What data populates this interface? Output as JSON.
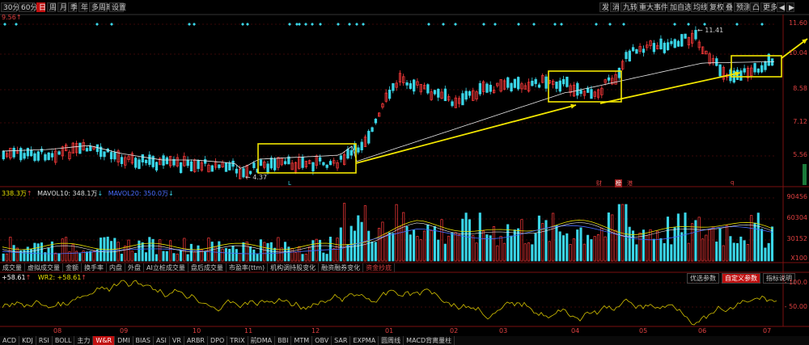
{
  "toolbar": {
    "left_buttons": [
      "30分",
      "60分",
      "日",
      "周",
      "月",
      "季",
      "年",
      "多周期",
      "设置"
    ],
    "active_index": 2,
    "right_buttons": [
      "发",
      "消",
      "九转",
      "重大事件",
      "加自选",
      "均线",
      "复权",
      "叠",
      "预测",
      "凸",
      "更多"
    ]
  },
  "price_panel": {
    "top_value": "9.56",
    "axis": [
      "11.60",
      "10.04",
      "8.58",
      "7.12",
      "5.56"
    ],
    "annotations": {
      "high": "11.41",
      "low": "4.37"
    },
    "event_marks": [
      "L",
      "财",
      "榜",
      "港",
      "q"
    ]
  },
  "volume_legend": {
    "vol": "338.3万",
    "ma10_label": "MAVOL10:",
    "ma10": "348.1万",
    "ma20_label": "MAVOL20:",
    "ma20": "350.0万"
  },
  "volume_axis": [
    "90456",
    "60304",
    "30152",
    "X100"
  ],
  "indicator_tabs": [
    "成交量",
    "虚拟成交量",
    "金额",
    "换手率",
    "内盘",
    "外盘",
    "AI立桩成交量",
    "盘后成交量",
    "市盈率(ttm)",
    "机构调持股变化",
    "融资融券变化",
    "资金抄底"
  ],
  "wr_legend": {
    "wr1": "+58.61",
    "wr2_label": "WR2:",
    "wr2": "+58.61"
  },
  "wr_buttons": [
    "优选参数",
    "自定义参数",
    "指标说明"
  ],
  "wr_axis": [
    "100.0",
    "50.00"
  ],
  "dates": [
    "08",
    "09",
    "10",
    "11",
    "12",
    "01",
    "02",
    "03",
    "04",
    "05",
    "06",
    "07"
  ],
  "bottom_tabs": [
    "ACD",
    "KDJ",
    "RSI",
    "BOLL",
    "主力",
    "W&R",
    "DMI",
    "BIAS",
    "ASI",
    "VR",
    "ARBR",
    "DPO",
    "TRIX",
    "前DMA",
    "BBI",
    "MTM",
    "OBV",
    "SAR",
    "EXPMA",
    "圆周线",
    "MACD背离量柱"
  ],
  "bottom_active": 5,
  "colors": {
    "up": "#ff3b3b",
    "down": "#3ad6e8",
    "ma": "#e8e8e8",
    "highlight": "#f2e600",
    "vol_ma10": "#e8e000",
    "vol_ma20": "#4a6cff"
  }
}
